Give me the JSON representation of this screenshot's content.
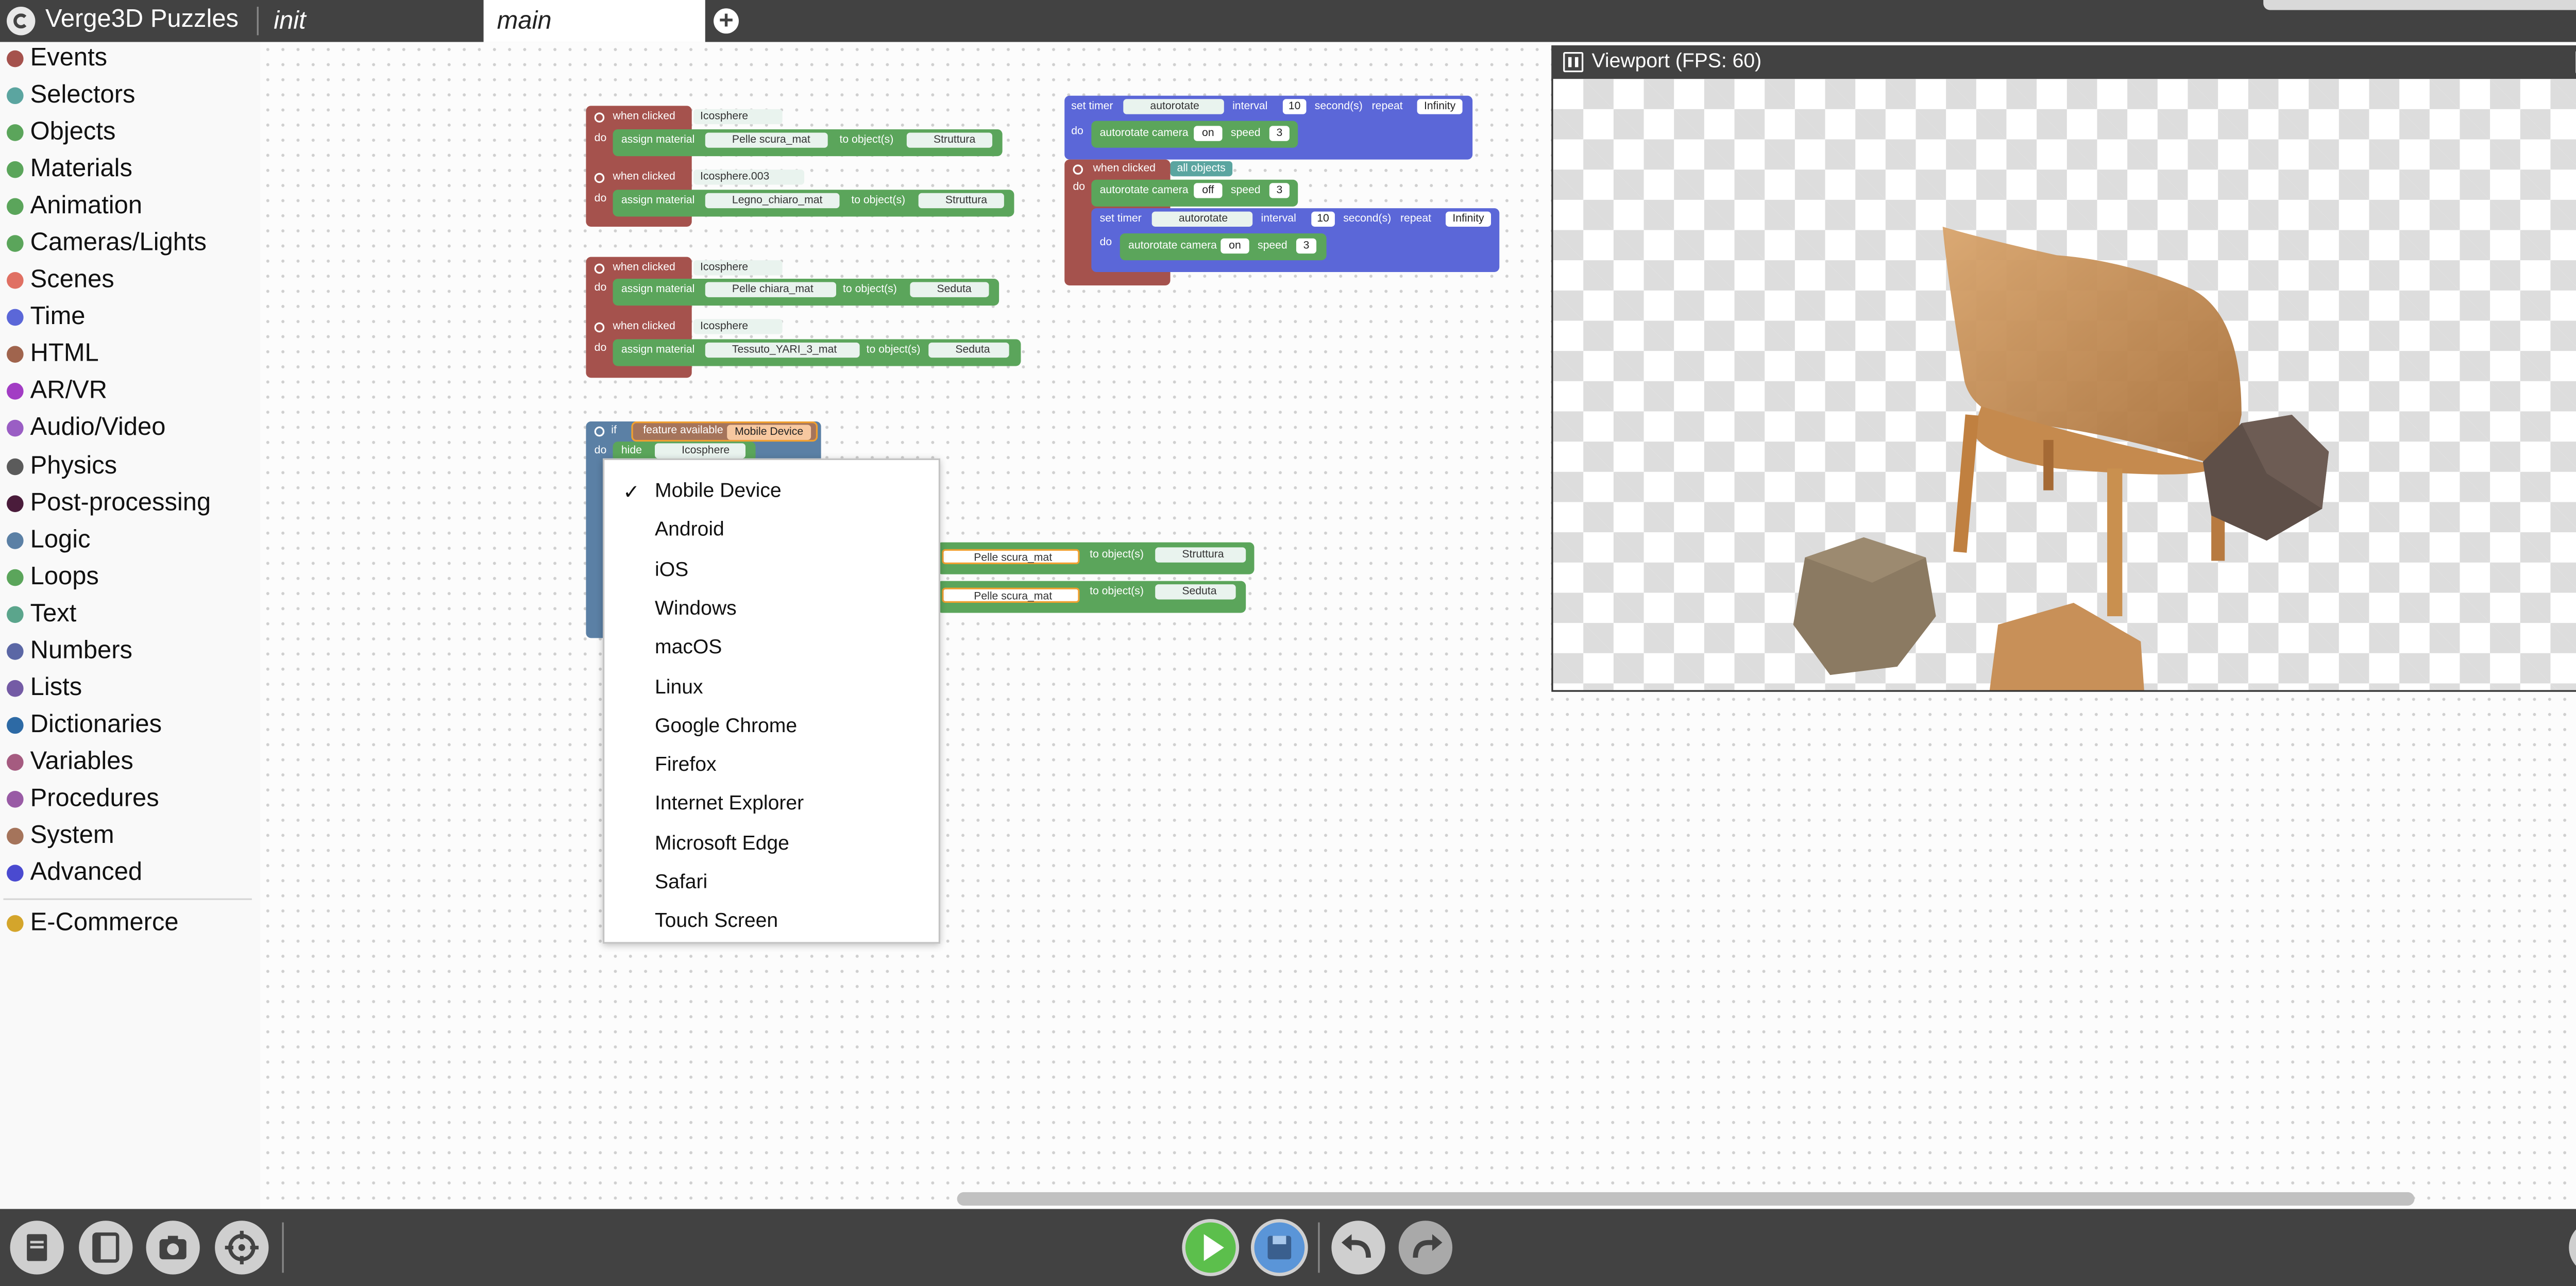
{
  "app": {
    "title": "Verge3D Puzzles"
  },
  "tabs": [
    {
      "label": "init"
    },
    {
      "label": "main"
    }
  ],
  "sidebar": {
    "categories": [
      {
        "label": "Events",
        "color": "#a5524d"
      },
      {
        "label": "Selectors",
        "color": "#5ba5a0"
      },
      {
        "label": "Objects",
        "color": "#5ba55b"
      },
      {
        "label": "Materials",
        "color": "#5ba55b"
      },
      {
        "label": "Animation",
        "color": "#5ba55b"
      },
      {
        "label": "Cameras/Lights",
        "color": "#5ba55b"
      },
      {
        "label": "Scenes",
        "color": "#e07063"
      },
      {
        "label": "Time",
        "color": "#5b67d8"
      },
      {
        "label": "HTML",
        "color": "#a0644d"
      },
      {
        "label": "AR/VR",
        "color": "#a23dc4"
      },
      {
        "label": "Audio/Video",
        "color": "#9a5ec4"
      },
      {
        "label": "Physics",
        "color": "#5b5b5b"
      },
      {
        "label": "Post-processing",
        "color": "#4a1c3b"
      },
      {
        "label": "Logic",
        "color": "#5b80a5"
      },
      {
        "label": "Loops",
        "color": "#5ba55b"
      },
      {
        "label": "Text",
        "color": "#5ba58c"
      },
      {
        "label": "Numbers",
        "color": "#5b67a5"
      },
      {
        "label": "Lists",
        "color": "#745ba5"
      },
      {
        "label": "Dictionaries",
        "color": "#2d6aa5"
      },
      {
        "label": "Variables",
        "color": "#a55b80"
      },
      {
        "label": "Procedures",
        "color": "#995ba5"
      },
      {
        "label": "System",
        "color": "#a5745b"
      },
      {
        "label": "Advanced",
        "color": "#4a4ad0"
      }
    ],
    "extra": {
      "label": "E-Commerce",
      "color": "#d4a52b"
    }
  },
  "blocks": {
    "when_clicked": "when clicked",
    "do": "do",
    "assign_material": "assign material",
    "to_objects": "to object(s)",
    "set_timer": "set timer",
    "interval": "interval",
    "seconds": "second(s)",
    "repeat": "repeat",
    "autorotate_camera": "autorotate camera",
    "speed": "speed",
    "all_objects": "all objects",
    "if": "if",
    "hide": "hide",
    "feature_available": "feature available",
    "g1": {
      "obj1": "Icosphere",
      "mat1": "Pelle scura_mat",
      "tgt1": "Struttura",
      "obj2": "Icosphere.003",
      "mat2": "Legno_chiaro_mat",
      "tgt2": "Struttura"
    },
    "g2": {
      "obj1": "Icosphere",
      "mat1": "Pelle chiara_mat",
      "tgt1": "Seduta",
      "obj2": "Icosphere",
      "mat2": "Tessuto_YARI_3_mat",
      "tgt2": "Seduta"
    },
    "g3": {
      "timer1": "autorotate",
      "interval1": "10",
      "repeat1": "Infinity",
      "cam1": "on",
      "speed1": "3",
      "cam2": "off",
      "speed2": "3",
      "timer2": "autorotate",
      "interval2": "10",
      "repeat2": "Infinity",
      "cam3": "on",
      "speed3": "3"
    },
    "g4": {
      "feature": "Mobile Device",
      "hide_obj": "Icosphere",
      "mat1": "Pelle scura_mat",
      "tgt1": "Struttura",
      "mat2": "Pelle scura_mat",
      "tgt2": "Seduta"
    }
  },
  "dropdown": {
    "options": [
      "Mobile Device",
      "Android",
      "iOS",
      "Windows",
      "macOS",
      "Linux",
      "Google Chrome",
      "Firefox",
      "Internet Explorer",
      "Microsoft Edge",
      "Safari",
      "Touch Screen"
    ],
    "check": "✓"
  },
  "viewport": {
    "title": "Viewport (FPS: 60)",
    "close": "✕"
  }
}
